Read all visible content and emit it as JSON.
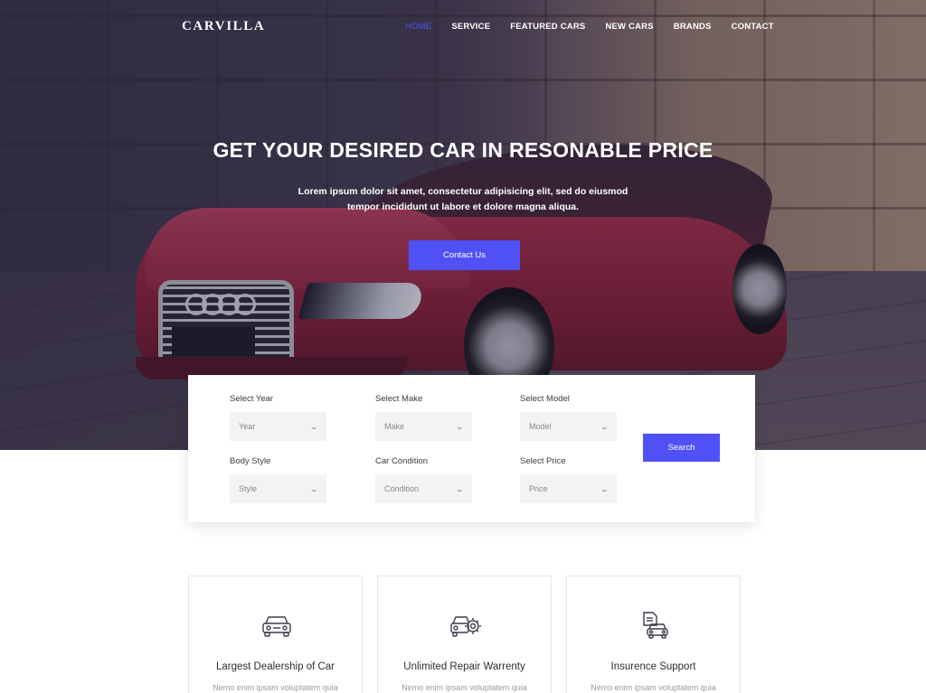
{
  "brand": {
    "name": "CARVILLA"
  },
  "nav": {
    "items": [
      {
        "label": "HOME",
        "active": true
      },
      {
        "label": "SERVICE",
        "active": false
      },
      {
        "label": "FEATURED CARS",
        "active": false
      },
      {
        "label": "NEW CARS",
        "active": false
      },
      {
        "label": "BRANDS",
        "active": false
      },
      {
        "label": "CONTACT",
        "active": false
      }
    ]
  },
  "hero": {
    "title": "GET YOUR DESIRED CAR IN RESONABLE PRICE",
    "text": "Lorem ipsum dolor sit amet, consectetur adipisicing elit, sed do eiusmod tempor incididunt ut labore et dolore magna aliqua.",
    "cta_label": "Contact Us"
  },
  "search": {
    "fields": [
      {
        "label": "Select Year",
        "placeholder": "Year"
      },
      {
        "label": "Select Make",
        "placeholder": "Make"
      },
      {
        "label": "Select Model",
        "placeholder": "Model"
      },
      {
        "label": "Body Style",
        "placeholder": "Style"
      },
      {
        "label": "Car Condition",
        "placeholder": "Condition"
      },
      {
        "label": "Select Price",
        "placeholder": "Price"
      }
    ],
    "button_label": "Search"
  },
  "features": [
    {
      "title": "Largest Dealership of Car",
      "text": "Nemo enim ipsam voluptatem quia",
      "icon": "car-icon"
    },
    {
      "title": "Unlimited Repair Warrenty",
      "text": "Nemo enim ipsam voluptatem quia",
      "icon": "car-repair-icon"
    },
    {
      "title": "Insurence Support",
      "text": "Nemo enim ipsam voluptatem quia",
      "icon": "car-insurance-icon"
    }
  ],
  "colors": {
    "accent": "#4f51f5",
    "field_bg": "#f3f3f6"
  }
}
